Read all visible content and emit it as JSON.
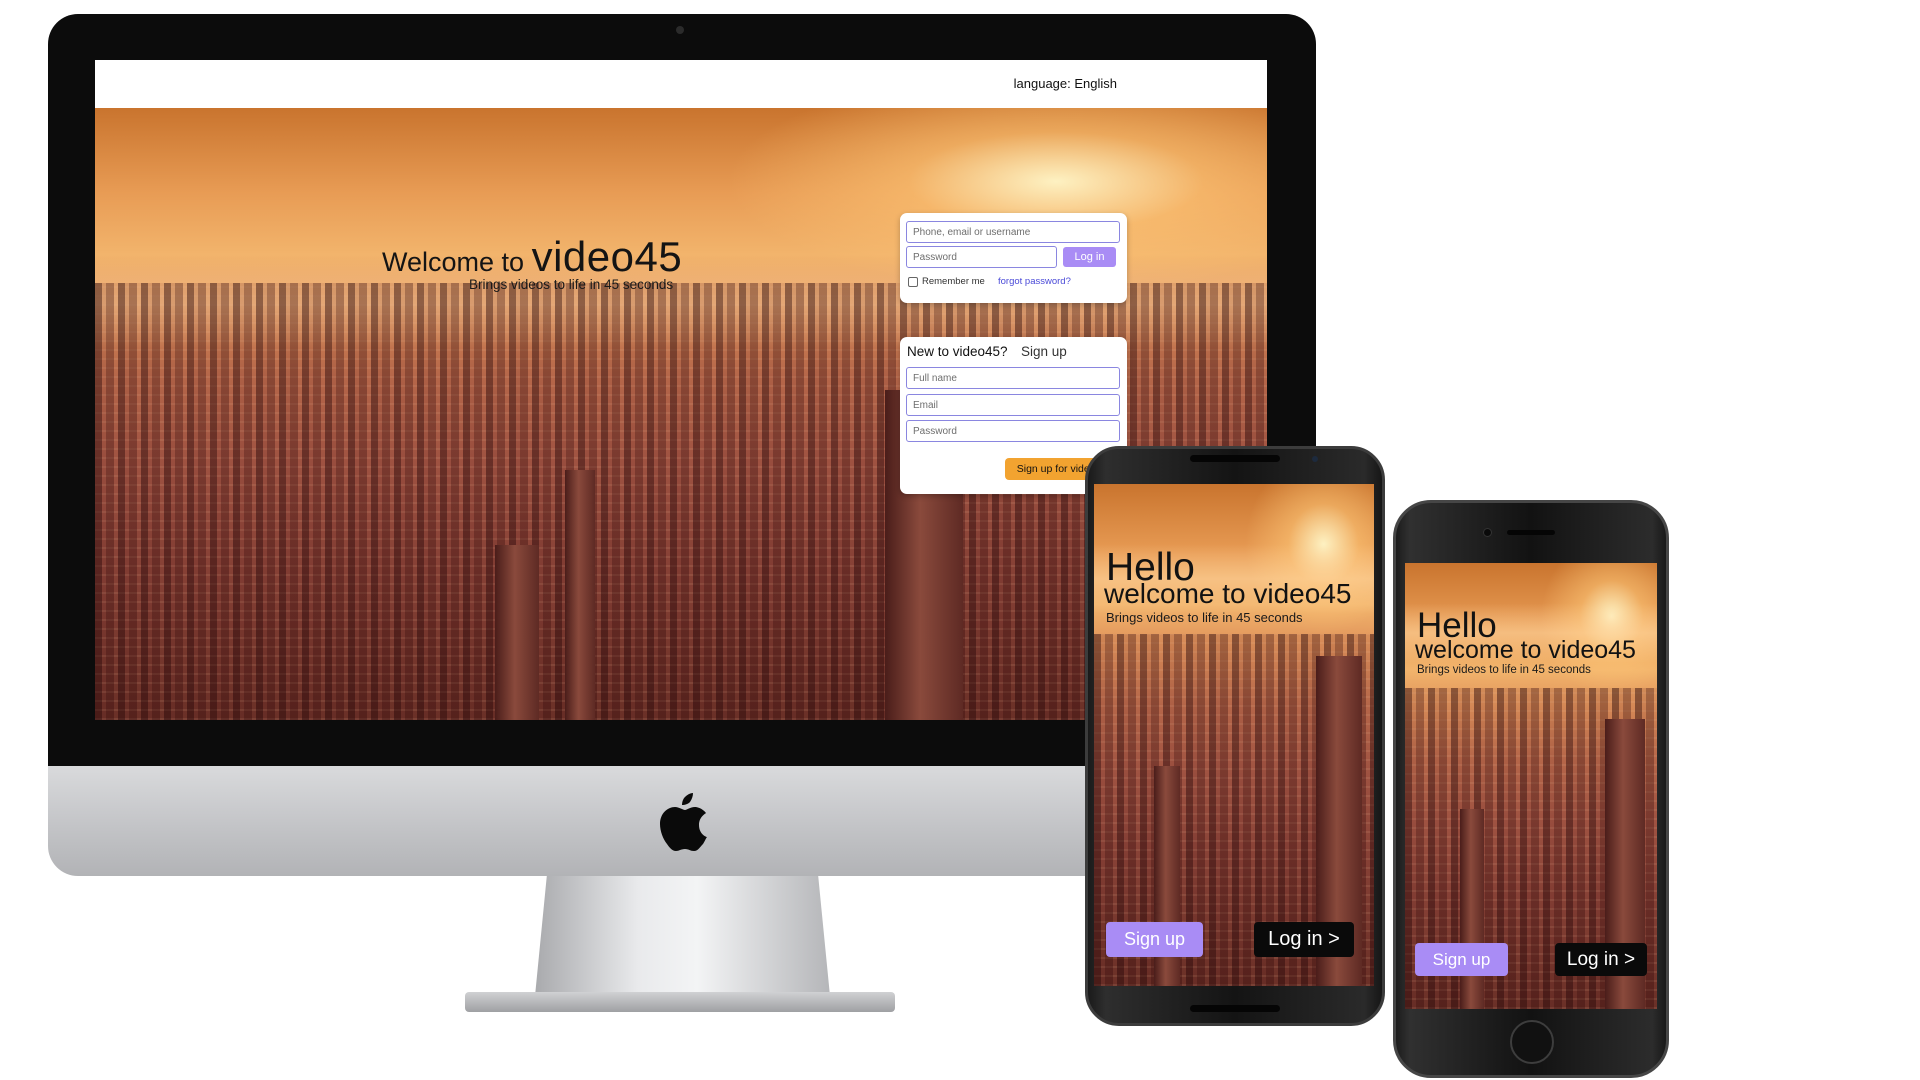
{
  "desktop": {
    "language_label": "language: English",
    "welcome_prefix": "Welcome to ",
    "brand": "video45",
    "tagline": "Brings videos to life in 45 seconds",
    "login": {
      "username_placeholder": "Phone, email or username",
      "password_placeholder": "Password",
      "login_button": "Log in",
      "remember_label": "Remember me",
      "forgot_link": "forgot password?"
    },
    "signup": {
      "heading": "New to video45?",
      "heading_link": "Sign up",
      "fullname_placeholder": "Full name",
      "email_placeholder": "Email",
      "password_placeholder": "Password",
      "signup_button": "Sign up for video45"
    }
  },
  "android": {
    "hello": "Hello",
    "welcome": "welcome to video45",
    "tagline": "Brings videos to life in 45 seconds",
    "signup_button": "Sign up",
    "login_button": "Log in >"
  },
  "iphone": {
    "hello": "Hello",
    "welcome": "welcome to video45",
    "tagline": "Brings videos to life in 45 seconds",
    "signup_button": "Sign up",
    "login_button": "Log in >"
  },
  "colors": {
    "accent_purple": "#a98cf5",
    "signup_orange": "#f2a330",
    "field_border": "#8a86e0",
    "link_blue": "#4a4ad8"
  }
}
